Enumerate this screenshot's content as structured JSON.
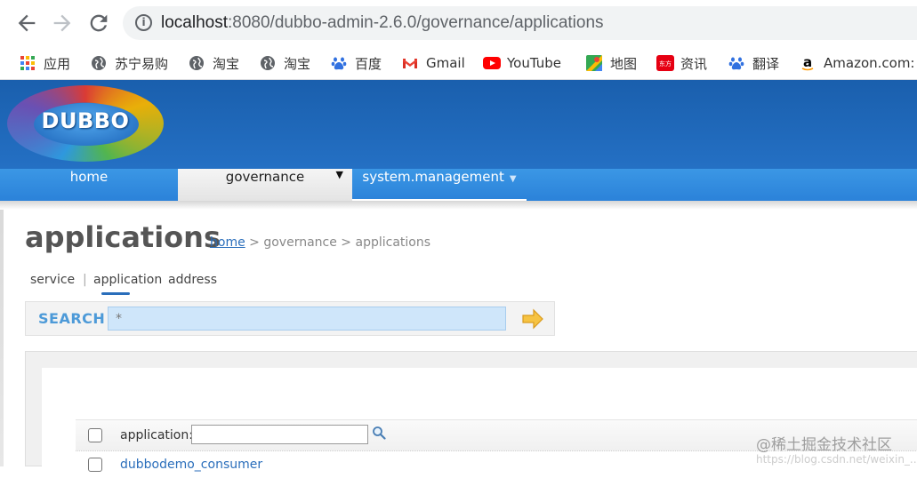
{
  "browser": {
    "url_host": "localhost",
    "url_path": ":8080/dubbo-admin-2.6.0/governance/applications",
    "bookmarks": [
      {
        "label": "应用",
        "icon": "apps-grid-icon"
      },
      {
        "label": "苏宁易购",
        "icon": "globe-icon"
      },
      {
        "label": "淘宝",
        "icon": "globe-icon"
      },
      {
        "label": "淘宝",
        "icon": "globe-icon"
      },
      {
        "label": "百度",
        "icon": "baidu-paw-icon"
      },
      {
        "label": "Gmail",
        "icon": "gmail-icon"
      },
      {
        "label": "YouTube",
        "icon": "youtube-icon"
      },
      {
        "label": "地图",
        "icon": "maps-icon"
      },
      {
        "label": "资讯",
        "icon": "dongfang-icon"
      },
      {
        "label": "翻译",
        "icon": "baidu-paw-icon"
      },
      {
        "label": "Amazon.com: (",
        "icon": "amazon-icon"
      }
    ]
  },
  "header": {
    "logo_text": "DUBBO"
  },
  "menu": {
    "home": "home",
    "governance": "governance",
    "system": "system.management"
  },
  "page": {
    "title": "applications",
    "breadcrumb": {
      "home": "home",
      "sep1": " > ",
      "governance": "governance",
      "sep2": " > ",
      "current": "applications"
    },
    "subtabs": {
      "service": "service",
      "separator": "|",
      "application": "application",
      "address": "address"
    },
    "search": {
      "label": "SEARCH",
      "value": "*"
    },
    "table": {
      "filter_label": "application:",
      "filter_value": "",
      "rows": [
        {
          "name": "dubbodemo_consumer"
        }
      ]
    }
  },
  "watermark": {
    "text": "@稀土掘金技术社区",
    "url": "https://blog.csdn.net/weixin_..."
  },
  "colors": {
    "header_blue": "#1a5fad",
    "menu_blue": "#2b82d9",
    "link_blue": "#2a6ebb",
    "search_label": "#4d9ad8"
  }
}
